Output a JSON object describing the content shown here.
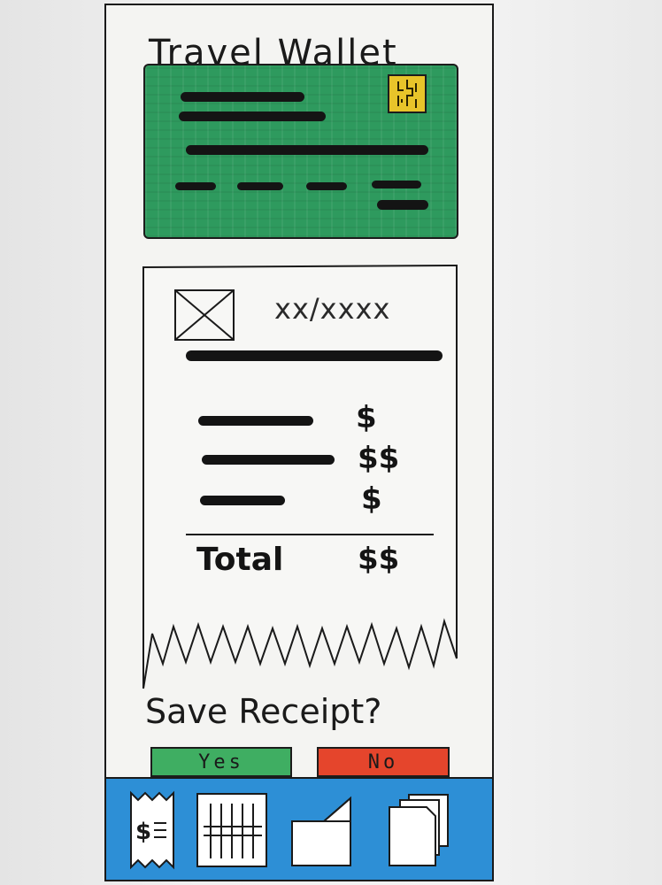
{
  "header": {
    "title": "Travel Wallet"
  },
  "card": {
    "color": "#2e9a5e",
    "chip_color": "#e8c42a"
  },
  "receipt": {
    "date": "xx/xxxx",
    "line_items": [
      {
        "amount": "$"
      },
      {
        "amount": "$$"
      },
      {
        "amount": "$"
      }
    ],
    "total_label": "Total",
    "total_amount": "$$"
  },
  "prompt": {
    "text": "Save Receipt?"
  },
  "actions": {
    "yes_label": "Yes",
    "no_label": "No",
    "yes_color": "#3fae62",
    "no_color": "#e5452c"
  },
  "navbar": {
    "color": "#2d8fd6",
    "items": [
      {
        "icon": "receipt-icon"
      },
      {
        "icon": "tally-icon"
      },
      {
        "icon": "folded-page-icon"
      },
      {
        "icon": "stacked-pages-icon"
      }
    ]
  }
}
